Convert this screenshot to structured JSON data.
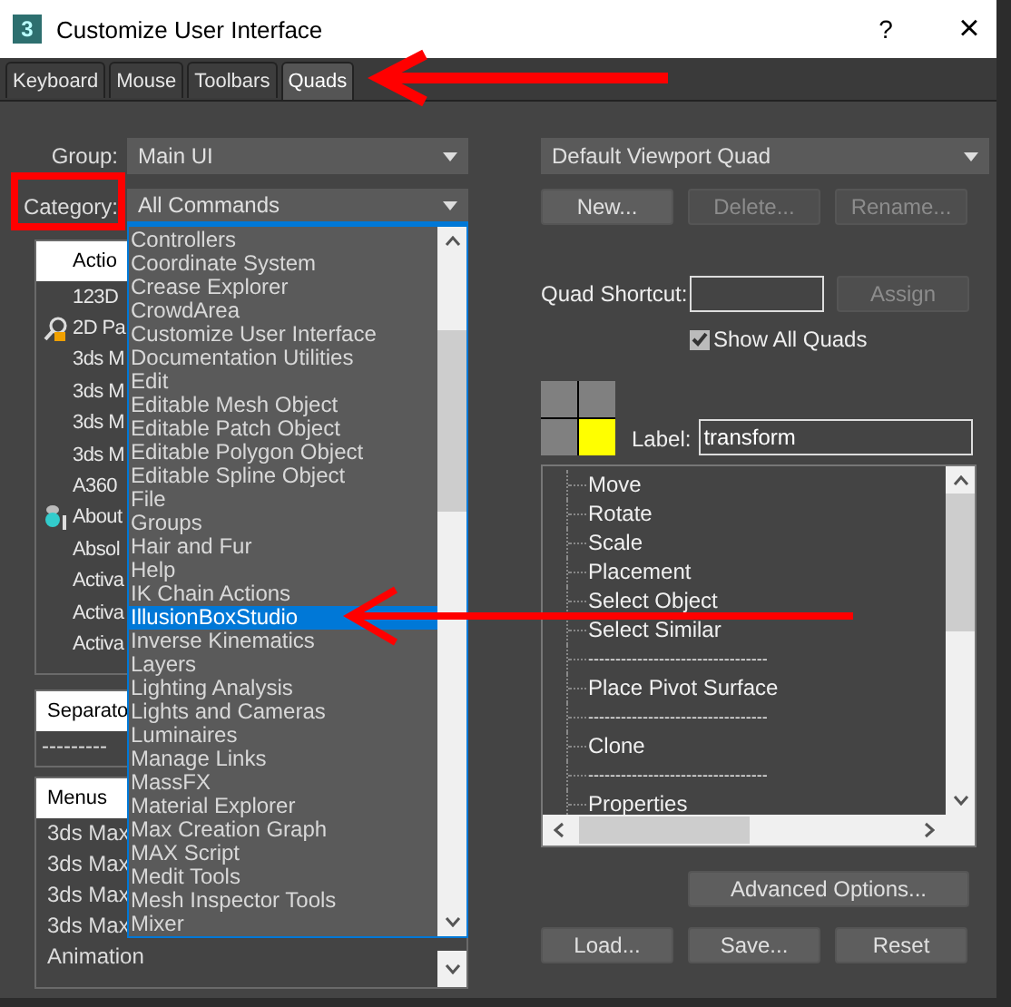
{
  "window": {
    "icon_text": "3",
    "title": "Customize User Interface",
    "help_button": "?",
    "close_button": "×"
  },
  "tabs": [
    {
      "label": "Keyboard",
      "selected": false
    },
    {
      "label": "Mouse",
      "selected": false
    },
    {
      "label": "Toolbars",
      "selected": false
    },
    {
      "label": "Quads",
      "selected": true
    }
  ],
  "group": {
    "label": "Group:",
    "value": "Main UI"
  },
  "category": {
    "label": "Category:",
    "value": "All Commands"
  },
  "category_dropdown": [
    {
      "label": "Controllers",
      "selected": false
    },
    {
      "label": "Coordinate System",
      "selected": false
    },
    {
      "label": "Crease Explorer",
      "selected": false
    },
    {
      "label": "CrowdArea",
      "selected": false
    },
    {
      "label": "Customize User Interface",
      "selected": false
    },
    {
      "label": "Documentation Utilities",
      "selected": false
    },
    {
      "label": "Edit",
      "selected": false
    },
    {
      "label": "Editable Mesh Object",
      "selected": false
    },
    {
      "label": "Editable Patch Object",
      "selected": false
    },
    {
      "label": "Editable Polygon Object",
      "selected": false
    },
    {
      "label": "Editable Spline Object",
      "selected": false
    },
    {
      "label": "File",
      "selected": false
    },
    {
      "label": "Groups",
      "selected": false
    },
    {
      "label": "Hair and Fur",
      "selected": false
    },
    {
      "label": "Help",
      "selected": false
    },
    {
      "label": "IK Chain Actions",
      "selected": false
    },
    {
      "label": "IllusionBoxStudio",
      "selected": true
    },
    {
      "label": "Inverse Kinematics",
      "selected": false
    },
    {
      "label": "Layers",
      "selected": false
    },
    {
      "label": "Lighting Analysis",
      "selected": false
    },
    {
      "label": "Lights and Cameras",
      "selected": false
    },
    {
      "label": "Luminaires",
      "selected": false
    },
    {
      "label": "Manage Links",
      "selected": false
    },
    {
      "label": "MassFX",
      "selected": false
    },
    {
      "label": "Material Explorer",
      "selected": false
    },
    {
      "label": "Max Creation Graph",
      "selected": false
    },
    {
      "label": "MAX Script",
      "selected": false
    },
    {
      "label": "Medit Tools",
      "selected": false
    },
    {
      "label": "Mesh Inspector Tools",
      "selected": false
    },
    {
      "label": "Mixer",
      "selected": false
    }
  ],
  "action_list": {
    "header": "Actio",
    "rows": [
      {
        "kind": "plain",
        "text": "123D"
      },
      {
        "kind": "search",
        "text": "2D Pa"
      },
      {
        "kind": "plain",
        "text": "3ds M"
      },
      {
        "kind": "plain",
        "text": "3ds M"
      },
      {
        "kind": "plain",
        "text": "3ds M"
      },
      {
        "kind": "plain",
        "text": "3ds M"
      },
      {
        "kind": "plain",
        "text": "A360"
      },
      {
        "kind": "info",
        "text": "About"
      },
      {
        "kind": "plain",
        "text": "Absol"
      },
      {
        "kind": "plain",
        "text": "Activa"
      },
      {
        "kind": "plain",
        "text": "Activa"
      },
      {
        "kind": "plain",
        "text": "Activa"
      }
    ]
  },
  "separator_list": {
    "header": "Separato",
    "rows": [
      "---------"
    ]
  },
  "menus_list": {
    "header": "Menus",
    "rows": [
      "3ds Max",
      "3ds Max",
      "3ds Max",
      "3ds Max",
      "Animation"
    ]
  },
  "quad_set": {
    "value": "Default Viewport Quad"
  },
  "quad_buttons": [
    {
      "label": "New...",
      "disabled": false
    },
    {
      "label": "Delete...",
      "disabled": true
    },
    {
      "label": "Rename...",
      "disabled": true
    }
  ],
  "quad_shortcut": {
    "label": "Quad Shortcut:"
  },
  "assign_button": {
    "label": "Assign",
    "disabled": true
  },
  "show_all_quads": {
    "label": "Show All Quads",
    "checked": true
  },
  "quadrants": [
    {
      "selected": false
    },
    {
      "selected": false
    },
    {
      "selected": false
    },
    {
      "selected": true
    }
  ],
  "quad_label": {
    "label": "Label:",
    "value": "transform"
  },
  "quad_menu_items": [
    {
      "kind": "item",
      "text": "Move"
    },
    {
      "kind": "item",
      "text": "Rotate"
    },
    {
      "kind": "item",
      "text": "Scale"
    },
    {
      "kind": "item",
      "text": "Placement"
    },
    {
      "kind": "item",
      "text": "Select Object"
    },
    {
      "kind": "item",
      "text": "Select Similar"
    },
    {
      "kind": "separator",
      "text": "---------------------------------"
    },
    {
      "kind": "item",
      "text": "Place Pivot Surface"
    },
    {
      "kind": "separator",
      "text": "---------------------------------"
    },
    {
      "kind": "item",
      "text": "Clone"
    },
    {
      "kind": "separator",
      "text": "---------------------------------"
    },
    {
      "kind": "item",
      "text": "Properties"
    }
  ],
  "advanced_button": "Advanced Options...",
  "footer_buttons": [
    "Load...",
    "Save...",
    "Reset"
  ]
}
